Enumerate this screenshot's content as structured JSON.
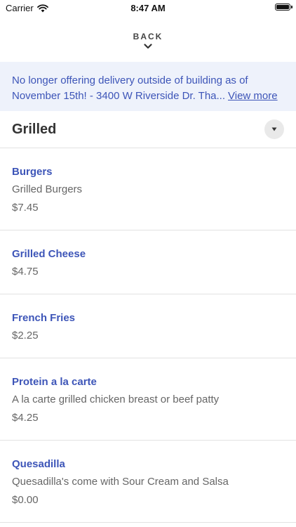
{
  "status_bar": {
    "carrier": "Carrier",
    "time": "8:47 AM",
    "wifi_icon": "wifi-icon",
    "battery_icon": "battery-icon"
  },
  "nav": {
    "back_label": "BACK",
    "chevron_icon": "chevron-down-icon"
  },
  "banner": {
    "line1": "No longer offering delivery outside of building as of",
    "line2": "November 15th! - 3400 W Riverside Dr. Tha...",
    "view_more": "View more",
    "background": "#eef2fb",
    "text_color": "#3d55b8"
  },
  "section": {
    "title": "Grilled",
    "dropdown_icon": "triangle-down-icon"
  },
  "items": [
    {
      "name": "Burgers",
      "description": "Grilled Burgers",
      "price": "$7.45"
    },
    {
      "name": "Grilled Cheese",
      "description": "",
      "price": "$4.75"
    },
    {
      "name": "French Fries",
      "description": "",
      "price": "$2.25"
    },
    {
      "name": "Protein a la carte",
      "description": "A la carte grilled chicken breast or beef patty",
      "price": "$4.25"
    },
    {
      "name": "Quesadilla",
      "description": "Quesadilla's come with Sour Cream and Salsa",
      "price": "$0.00"
    }
  ],
  "colors": {
    "accent": "#3d55b8",
    "divider": "#e2e2e2"
  }
}
